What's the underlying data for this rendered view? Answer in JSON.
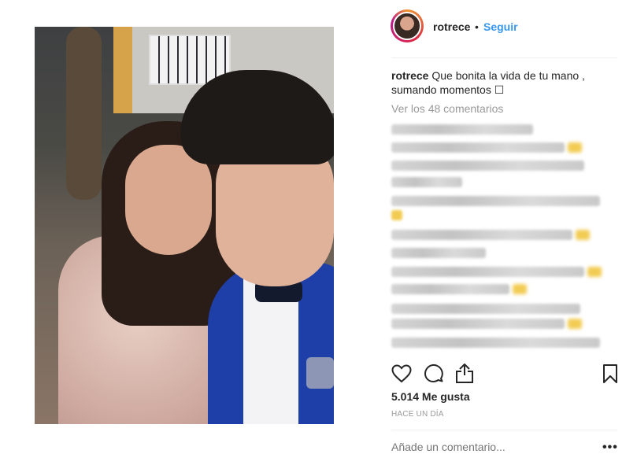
{
  "post": {
    "username": "rotrece",
    "separator": "•",
    "follow_label": "Seguir",
    "caption_user": "rotrece",
    "caption_text": "Que bonita la vida de tu mano , sumando momentos ☐",
    "view_comments": "Ver los 48 comentarios",
    "likes": "5.014 Me gusta",
    "timestamp": "HACE UN DÍA",
    "comment_placeholder": "Añade un comentario...",
    "more_label": "•••"
  },
  "icons": {
    "like": "heart-icon",
    "comment": "speech-bubble-icon",
    "share": "share-icon",
    "save": "bookmark-icon"
  },
  "colors": {
    "accent": "#3897f0",
    "muted": "#999999",
    "text": "#262626"
  }
}
